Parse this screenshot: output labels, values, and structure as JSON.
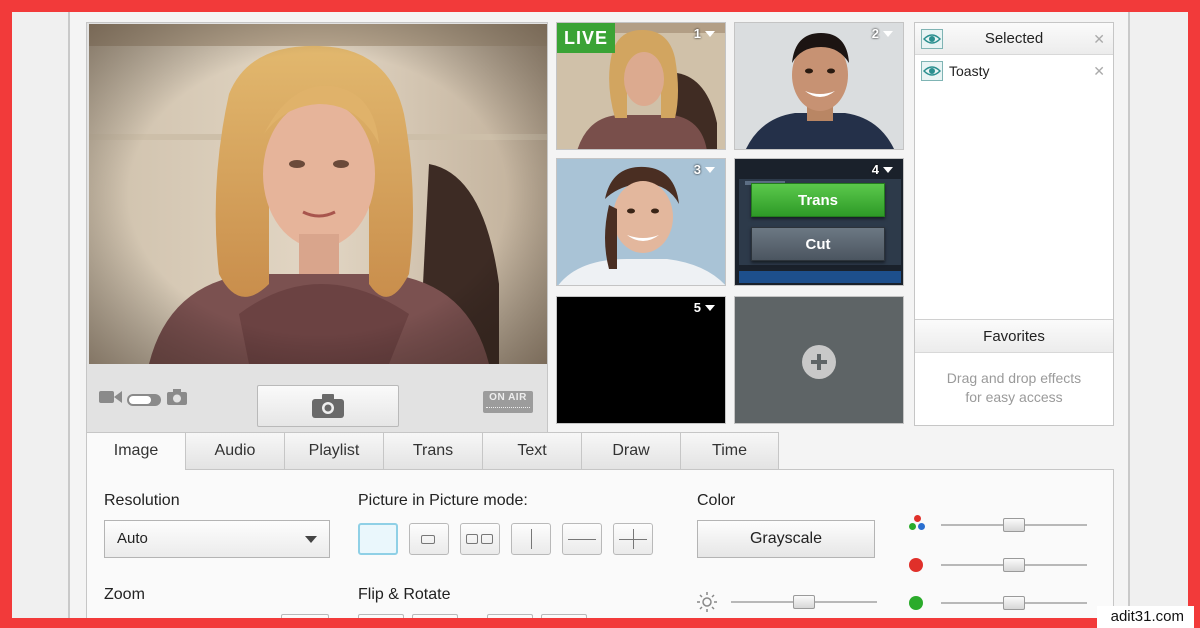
{
  "preview": {
    "onair_label": "ON AIR"
  },
  "sources": {
    "live_label": "LIVE",
    "items": [
      {
        "number": "1"
      },
      {
        "number": "2"
      },
      {
        "number": "3"
      },
      {
        "number": "4"
      },
      {
        "number": "5"
      }
    ],
    "trans_label": "Trans",
    "cut_label": "Cut"
  },
  "effects_panel": {
    "selected_title": "Selected",
    "selected_items": [
      "Toasty"
    ],
    "favorites_title": "Favorites",
    "favorites_hint_line1": "Drag and drop effects",
    "favorites_hint_line2": "for easy access"
  },
  "tabs": [
    "Image",
    "Audio",
    "Playlist",
    "Trans",
    "Text",
    "Draw",
    "Time"
  ],
  "active_tab": "Image",
  "image_tab": {
    "resolution_label": "Resolution",
    "resolution_value": "Auto",
    "zoom_label": "Zoom",
    "pip_label": "Picture in Picture mode:",
    "flip_label": "Flip & Rotate",
    "color_label": "Color",
    "grayscale_label": "Grayscale"
  },
  "colors": {
    "border": "#f23a3a",
    "live": "#3aa335",
    "red_channel": "#e0302a",
    "green_channel": "#2bab2b"
  },
  "watermark": "adit31.com"
}
